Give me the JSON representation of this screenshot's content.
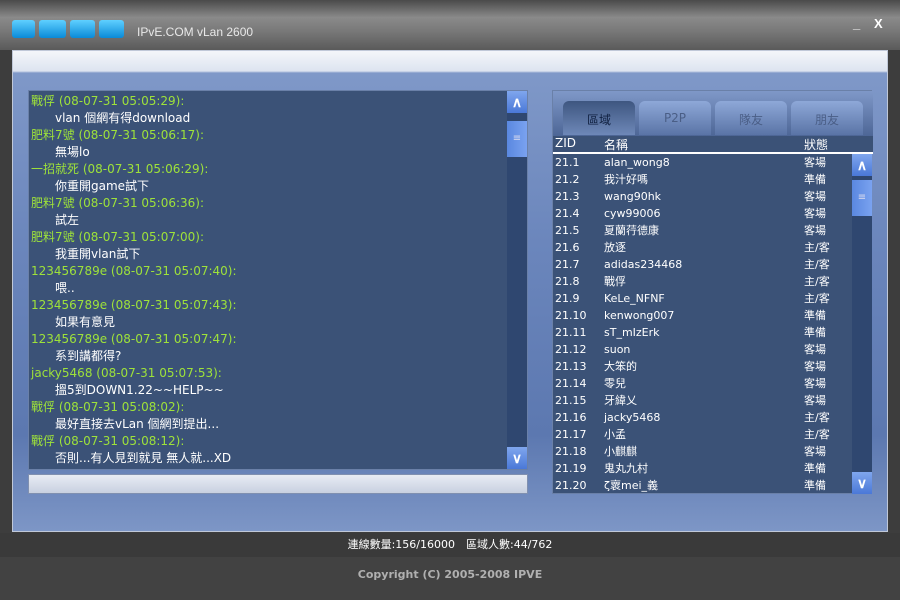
{
  "window": {
    "logo": "IPVE",
    "title": "IPvE.COM vLan 2600",
    "minimize": "_",
    "close": "X"
  },
  "chat": {
    "messages": [
      {
        "header": "戰俘 (08-07-31 05:05:29):",
        "text": "vlan 個網有得download"
      },
      {
        "header": "肥料7號 (08-07-31 05:06:17):",
        "text": "無場lo"
      },
      {
        "header": "一招就死 (08-07-31 05:06:29):",
        "text": "你重開game試下"
      },
      {
        "header": "肥料7號 (08-07-31 05:06:36):",
        "text": "試左"
      },
      {
        "header": "肥料7號 (08-07-31 05:07:00):",
        "text": "我重開vlan試下"
      },
      {
        "header": "123456789e (08-07-31 05:07:40):",
        "text": "喂.."
      },
      {
        "header": "123456789e (08-07-31 05:07:43):",
        "text": "如果有意見"
      },
      {
        "header": "123456789e (08-07-31 05:07:47):",
        "text": "系到講都得?"
      },
      {
        "header": "jacky5468 (08-07-31 05:07:53):",
        "text": "搵5到DOWN1.22~~HELP~~"
      },
      {
        "header": "戰俘 (08-07-31 05:08:02):",
        "text": "最好直接去vLan 個網到提出..."
      },
      {
        "header": "戰俘 (08-07-31 05:08:12):",
        "text": "否則...有人見到就見 無人就...XD"
      }
    ],
    "input_value": "",
    "scroll_up": "∧",
    "scroll_down": "∨"
  },
  "tabs": [
    "區域",
    "P2P",
    "隊友",
    "朋友"
  ],
  "list": {
    "columns": [
      "ZID",
      "名稱",
      "狀態"
    ],
    "rows": [
      [
        "21.1",
        "alan_wong8",
        "客場"
      ],
      [
        "21.2",
        "我汁好嗎",
        "準備"
      ],
      [
        "21.3",
        "wang90hk",
        "客場"
      ],
      [
        "21.4",
        "cyw99006",
        "客場"
      ],
      [
        "21.5",
        "夏蘭荇德康",
        "客場"
      ],
      [
        "21.6",
        "放逐",
        "主/客"
      ],
      [
        "21.7",
        "adidas234468",
        "主/客"
      ],
      [
        "21.8",
        "戰俘",
        "主/客"
      ],
      [
        "21.9",
        "KeLe_NFNF",
        "主/客"
      ],
      [
        "21.10",
        "kenwong007",
        "準備"
      ],
      [
        "21.11",
        "sT_mIzErk",
        "準備"
      ],
      [
        "21.12",
        "suon",
        "客場"
      ],
      [
        "21.13",
        "大笨的",
        "客場"
      ],
      [
        "21.14",
        "零兒",
        "客場"
      ],
      [
        "21.15",
        "牙緯乂",
        "客場"
      ],
      [
        "21.16",
        "jacky5468",
        "主/客"
      ],
      [
        "21.17",
        "小孟",
        "主/客"
      ],
      [
        "21.18",
        "小麒麒",
        "客場"
      ],
      [
        "21.19",
        "鬼丸九村",
        "準備"
      ],
      [
        "21.20",
        "ζ褱mei_義",
        "準備"
      ]
    ]
  },
  "status": "連線數量:156/16000　區域人數:44/762",
  "footer": "Copyright (C) 2005-2008 IPVE"
}
